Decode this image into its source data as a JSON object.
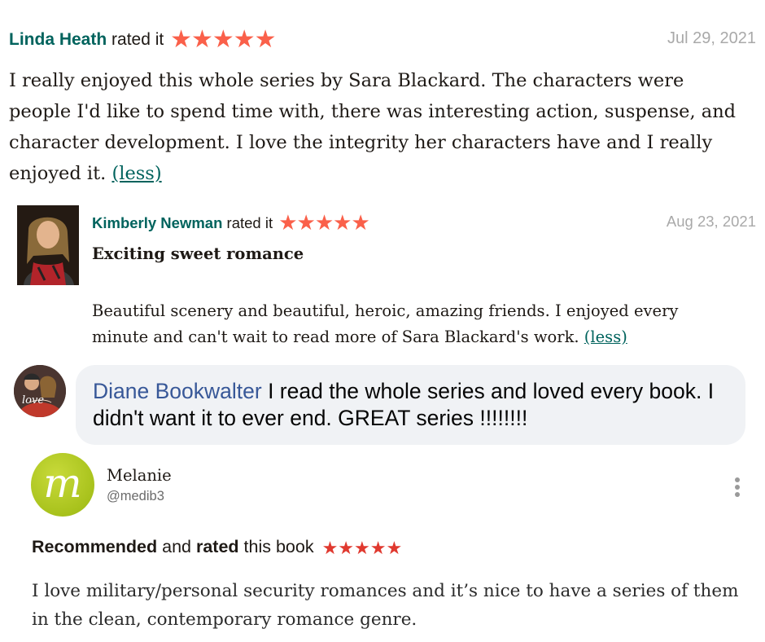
{
  "review1": {
    "name": "Linda Heath",
    "rated_text": "rated it",
    "stars": "★★★★★",
    "date": "Jul 29, 2021",
    "body": "I really enjoyed this whole series by Sara Blackard. The characters were people I'd like to spend time with, there was interesting action, suspense, and character development. I love the integrity her characters have and I really enjoyed it.",
    "toggle": "(less)"
  },
  "review2": {
    "name": "Kimberly Newman",
    "rated_text": "rated it",
    "stars": "★★★★★",
    "date": "Aug 23, 2021",
    "title": "Exciting sweet romance",
    "body": "Beautiful scenery and beautiful, heroic, amazing friends. I enjoyed every minute and can't wait to read more of Sara Blackard's work.",
    "toggle": "(less)"
  },
  "comment": {
    "name": "Diane Bookwalter",
    "text": "I read the whole series and loved every book. I didn't want it to ever end. GREAT series !!!!!!!!",
    "avatar_text": "love"
  },
  "post": {
    "name": "Melanie",
    "handle": "@medib3",
    "avatar_letter": "m",
    "rec_word": "Recommended",
    "and_word": "and",
    "rated_word": "rated",
    "tail_text": "this book",
    "stars": "★★★★★",
    "body": "I love military/personal security romances and it’s nice to have a series of them in the clean, contemporary romance genre."
  },
  "colors": {
    "goodreads_green": "#00635d",
    "star_orange": "#fa604a",
    "facebook_blue": "#385898",
    "bubble_gray": "#f0f2f5",
    "avatar_lime": "#a8c21c"
  }
}
